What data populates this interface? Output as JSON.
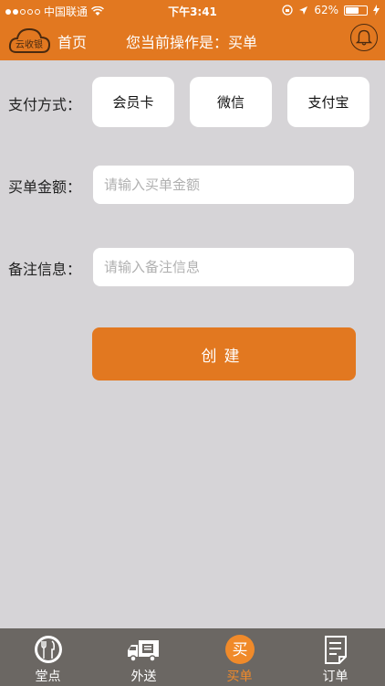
{
  "status_bar": {
    "carrier": "中国联通",
    "time": "下午3:41",
    "battery": "62%",
    "battery_level": 0.62
  },
  "header": {
    "logo_text": "云收银",
    "home_label": "首页",
    "title": "您当前操作是：买单"
  },
  "form": {
    "payment_label": "支付方式：",
    "payment_methods": [
      "会员卡",
      "微信",
      "支付宝"
    ],
    "amount_label": "买单金额：",
    "amount_placeholder": "请输入买单金额",
    "note_label": "备注信息：",
    "note_placeholder": "请输入备注信息",
    "create_label": "创建"
  },
  "tabs": [
    {
      "label": "堂点",
      "icon": "plate-icon"
    },
    {
      "label": "外送",
      "icon": "delivery-truck-icon"
    },
    {
      "label": "买单",
      "icon": "buy-icon",
      "icon_char": "买"
    },
    {
      "label": "订单",
      "icon": "order-list-icon"
    }
  ],
  "colors": {
    "accent": "#e27820",
    "background": "#d6d4d7",
    "tabbar": "#6b6763"
  }
}
